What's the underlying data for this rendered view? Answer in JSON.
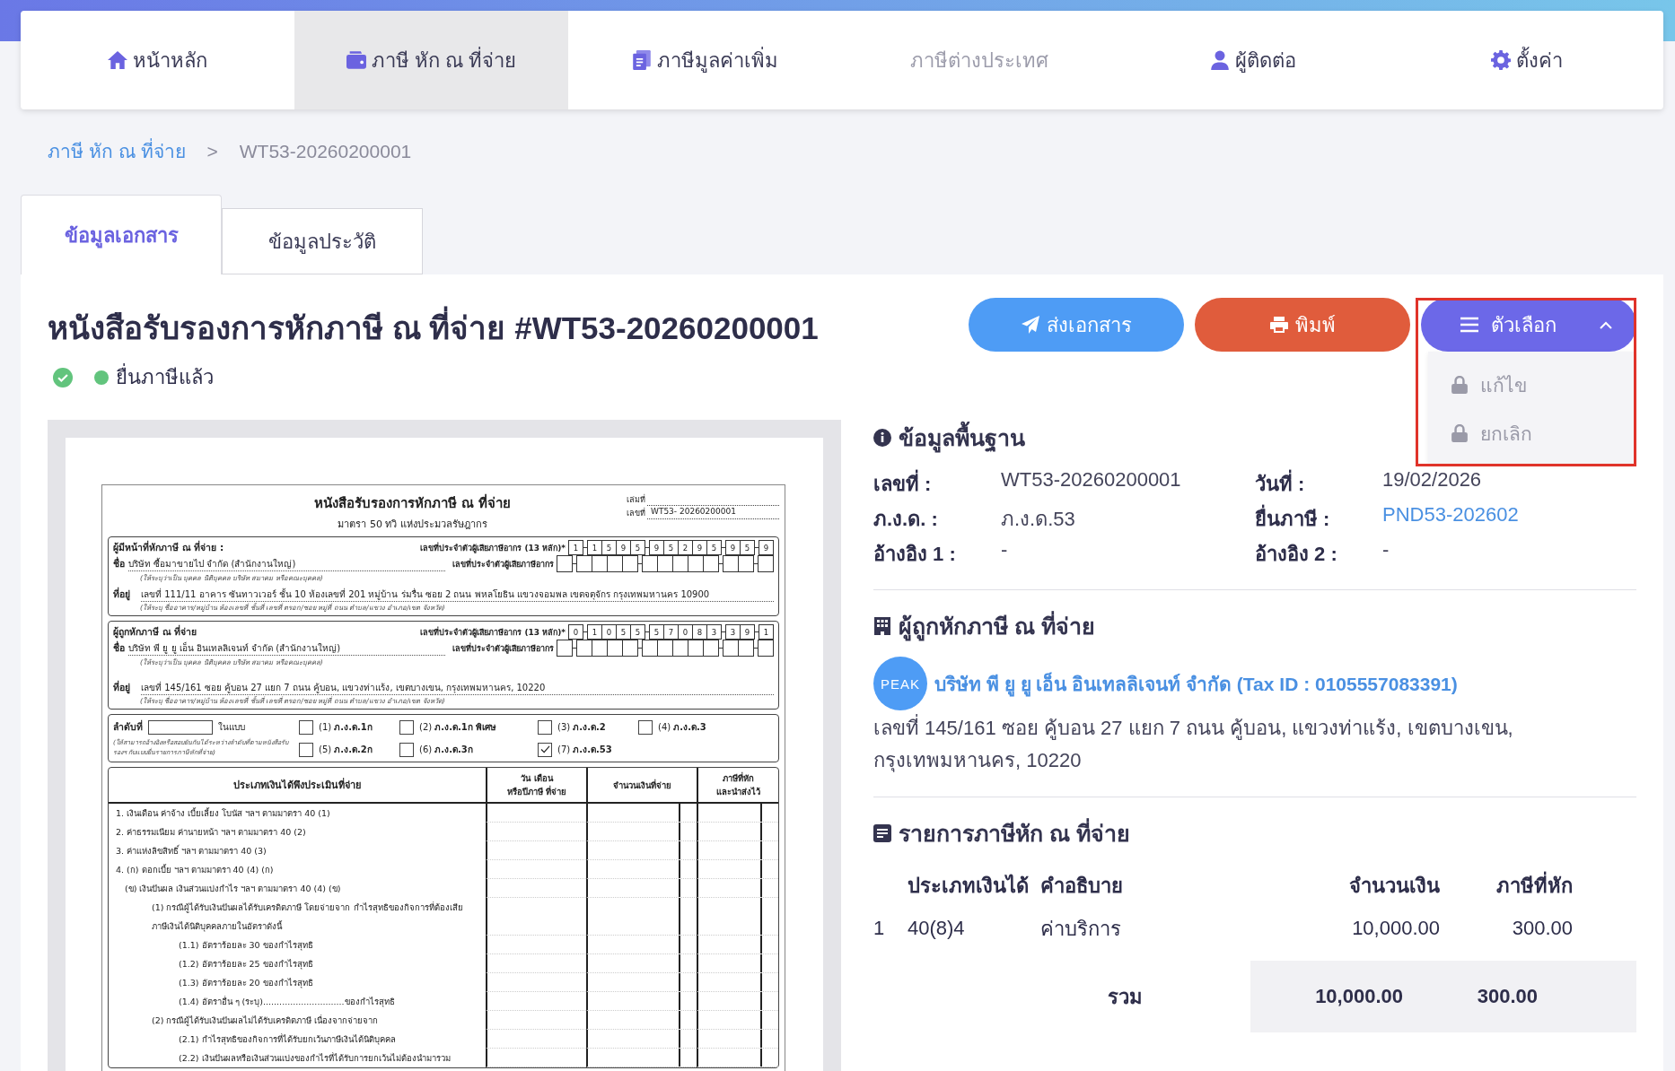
{
  "nav": {
    "items": [
      {
        "label": "หน้าหลัก",
        "selected": false,
        "disabled": false
      },
      {
        "label": "ภาษี หัก ณ ที่จ่าย",
        "selected": true,
        "disabled": false
      },
      {
        "label": "ภาษีมูลค่าเพิ่ม",
        "selected": false,
        "disabled": false
      },
      {
        "label": "ภาษีต่างประเทศ",
        "selected": false,
        "disabled": true
      },
      {
        "label": "ผู้ติดต่อ",
        "selected": false,
        "disabled": false
      },
      {
        "label": "ตั้งค่า",
        "selected": false,
        "disabled": false
      }
    ]
  },
  "breadcrumb": {
    "parent": "ภาษี หัก ณ ที่จ่าย",
    "separator": ">",
    "current": "WT53-20260200001"
  },
  "tabs": [
    {
      "label": "ข้อมูลเอกสาร",
      "selected": true
    },
    {
      "label": "ข้อมูลประวัติ",
      "selected": false
    }
  ],
  "document": {
    "title": "หนังสือรับรองการหักภาษี ณ ที่จ่าย #WT53-20260200001",
    "status": "ยื่นภาษีแล้ว",
    "buttons": [
      {
        "label": "ส่งเอกสาร",
        "kind": "send"
      },
      {
        "label": "พิมพ์",
        "kind": "print"
      },
      {
        "label": "ตัวเลือก",
        "kind": "options",
        "expanded": true,
        "menu": [
          {
            "label": "แก้ไข",
            "disabled": true
          },
          {
            "label": "ยกเลิก",
            "disabled": true
          }
        ]
      }
    ]
  },
  "form": {
    "title": "หนังสือรับรองการหักภาษี ณ ที่จ่าย",
    "subtitle": "มาตรา 50 ทวิ แห่งประมวลรัษฎากร",
    "book_label": "เล่มที่",
    "number_label": "เลขที่",
    "number": "WT53- 20260200001",
    "parties": [
      {
        "heading": "ผู้มีหน้าที่หักภาษี ณ ที่จ่าย :",
        "id_label": "เลขที่ประจำตัวผู้เสียภาษีอากร (13 หลัก)*",
        "id_digits": [
          "1",
          "1",
          "5",
          "9",
          "5",
          "9",
          "5",
          "2",
          "9",
          "5",
          "9",
          "5",
          "9"
        ],
        "name_label": "ชื่อ",
        "name": "บริษัท ซื้อมาขายไป จำกัด (สำนักงานใหญ่)",
        "name_hint": "(ให้ระบุว่าเป็น บุคคล นิติบุคคล บริษัท สมาคม หรือคณะบุคคล)",
        "id2_label": "เลขที่ประจำตัวผู้เสียภาษีอากร",
        "address_label": "ที่อยู่",
        "address": "เลขที่ 111/11 อาคาร ซันทาวเวอร์ ชั้น 10 ห้องเลขที่ 201 หมู่บ้าน ร่มรื่น ซอย 2 ถนน พหลโยธิน แขวงจอมพล เขตจตุจักร กรุงเทพมหานคร 10900",
        "address_hint": "(ให้ระบุ ชื่ออาคาร/หมู่บ้าน ห้องเลขที่ ชั้นที่ เลขที่ ตรอก/ซอย หมู่ที่ ถนน ตำบล/แขวง อำเภอ/เขต จังหวัด)"
      },
      {
        "heading": "ผู้ถูกหักภาษี ณ ที่จ่าย",
        "id_label": "เลขที่ประจำตัวผู้เสียภาษีอากร (13 หลัก)*",
        "id_digits": [
          "0",
          "1",
          "0",
          "5",
          "5",
          "5",
          "7",
          "0",
          "8",
          "3",
          "3",
          "9",
          "1"
        ],
        "name_label": "ชื่อ",
        "name": "บริษัท พี ยู ยู เอ็น อินเทลลิเจนท์ จำกัด (สำนักงานใหญ่)",
        "name_hint": "(ให้ระบุว่าเป็น บุคคล นิติบุคคล บริษัท สมาคม หรือคณะบุคคล)",
        "id2_label": "เลขที่ประจำตัวผู้เสียภาษีอากร",
        "address_label": "ที่อยู่",
        "address": "เลขที่ 145/161 ซอย คู้บอน 27 แยก 7 ถนน คู้บอน, แขวงท่าแร้ง, เขตบางเขน, กรุงเทพมหานคร, 10220",
        "address_hint": "(ให้ระบุ ชื่ออาคาร/หมู่บ้าน ห้องเลขที่ ชั้นที่ เลขที่ ตรอก/ซอย หมู่ที่ ถนน ตำบล/แขวง อำเภอ/เขต จังหวัด)"
      }
    ],
    "sequence": {
      "label": "ลำดับที่",
      "in_form": "ในแบบ",
      "hint": "(ให้สามารถอ้างอิงหรือสอบยันกันได้ระหว่างลำดับที่ตามหนังสือรับรองฯ กับแบบยื่นรายการภาษีหักที่จ่าย)",
      "forms": [
        {
          "number": "(1)",
          "name": "ภ.ง.ด.1ก",
          "checked": false
        },
        {
          "number": "(2)",
          "name": "ภ.ง.ด.1ก พิเศษ",
          "checked": false
        },
        {
          "number": "(3)",
          "name": "ภ.ง.ด.2",
          "checked": false
        },
        {
          "number": "(4)",
          "name": "ภ.ง.ด.3",
          "checked": false
        },
        {
          "number": "(5)",
          "name": "ภ.ง.ด.2ก",
          "checked": false
        },
        {
          "number": "(6)",
          "name": "ภ.ง.ด.3ก",
          "checked": false
        },
        {
          "number": "(7)",
          "name": "ภ.ง.ด.53",
          "checked": true
        }
      ]
    },
    "income_table": {
      "columns": [
        "ประเภทเงินได้พึงประเมินที่จ่าย",
        "วัน เดือน\nหรือปีภาษี ที่จ่าย",
        "จำนวนเงินที่จ่าย",
        "ภาษีที่หัก\nและนำส่งไว้"
      ],
      "rows": [
        {
          "text": "1. เงินเดือน ค่าจ้าง เบี้ยเลี้ยง โบนัส ฯลฯ ตามมาตรา 40 (1)"
        },
        {
          "text": "2. ค่าธรรมเนียม ค่านายหน้า ฯลฯ ตามมาตรา 40 (2)"
        },
        {
          "text": "3. ค่าแห่งลิขสิทธิ์ ฯลฯ ตามมาตรา 40 (3)"
        },
        {
          "text": "4.  (ก) ดอกเบี้ย ฯลฯ ตามมาตรา 40 (4) (ก)",
          "children": [
            {
              "text": "(ข) เงินปันผล เงินส่วนแบ่งกำไร ฯลฯ ตามมาตรา 40 (4) (ข)",
              "children": [
                {
                  "text": "(1) กรณีผู้ได้รับเงินปันผลได้รับเครดิตภาษี  โดยจ่ายจาก กำไรสุทธิของกิจการที่ต้องเสียภาษีเงินได้นิติบุคคลภายในอัตราดังนี้",
                  "children": [
                    {
                      "text": "(1.1) อัตราร้อยละ 30 ของกำไรสุทธิ"
                    },
                    {
                      "text": "(1.2) อัตราร้อยละ 25 ของกำไรสุทธิ"
                    },
                    {
                      "text": "(1.3) อัตราร้อยละ 20 ของกำไรสุทธิ"
                    },
                    {
                      "text": "(1.4) อัตราอื่น ๆ (ระบุ)..............................ของกำไรสุทธิ"
                    }
                  ]
                },
                {
                  "text": "(2) กรณีผู้ได้รับเงินปันผลไม่ได้รับเครดิตภาษี เนื่องจากจ่ายจาก",
                  "children": [
                    {
                      "text": "(2.1) กำไรสุทธิของกิจการที่ได้รับยกเว้นภาษีเงินได้นิติบุคคล"
                    },
                    {
                      "text": "(2.2) เงินปันผลหรือเงินส่วนแบ่งของกำไรที่ได้รับการยกเว้นไม่ต้องนำมารวม"
                    }
                  ]
                }
              ]
            }
          ]
        }
      ]
    }
  },
  "basic_info": {
    "title": "ข้อมูลพื้นฐาน",
    "fields": [
      {
        "label": "เลขที่ :",
        "value": "WT53-20260200001",
        "link": false
      },
      {
        "label": "วันที่ :",
        "value": "19/02/2026",
        "link": false
      },
      {
        "label": "ภ.ง.ด. :",
        "value": "ภ.ง.ด.53",
        "link": false
      },
      {
        "label": "ยื่นภาษี :",
        "value": "PND53-202602",
        "link": true
      },
      {
        "label": "อ้างอิง 1 :",
        "value": "-",
        "link": false
      },
      {
        "label": "อ้างอิง 2 :",
        "value": "-",
        "link": false
      }
    ]
  },
  "payee": {
    "title": "ผู้ถูกหักภาษี ณ ที่จ่าย",
    "logo": "PEAK",
    "name": "บริษัท พี ยู ยู เอ็น อินเทลลิเจนท์ จำกัด (Tax ID : 0105557083391)",
    "address": "เลขที่ 145/161 ซอย คู้บอน 27 แยก 7 ถนน คู้บอน, แขวงท่าแร้ง, เขตบางเขน, กรุงเทพมหานคร, 10220"
  },
  "withholding": {
    "title": "รายการภาษีหัก ณ ที่จ่าย",
    "columns": [
      "ประเภทเงินได้",
      "คำอธิบาย",
      "จำนวนเงิน",
      "ภาษีที่หัก"
    ],
    "rows": [
      {
        "no": "1",
        "type": "40(8)4",
        "description": "ค่าบริการ",
        "amount": "10,000.00",
        "tax": "300.00"
      }
    ],
    "total": {
      "label": "รวม",
      "amount": "10,000.00",
      "tax": "300.00"
    }
  }
}
